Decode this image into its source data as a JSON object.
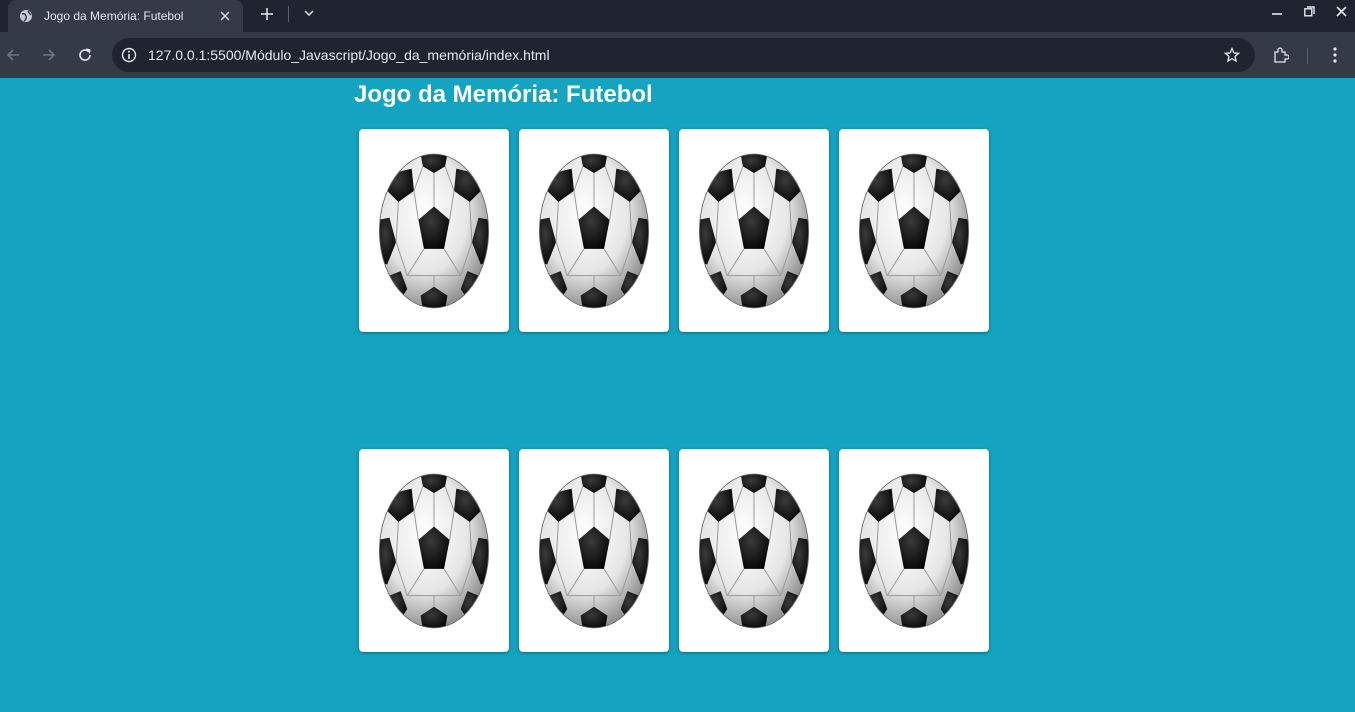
{
  "browser": {
    "tab_title": "Jogo da Memória: Futebol",
    "url": "127.0.0.1:5500/Módulo_Javascript/Jogo_da_memória/index.html",
    "icons": [
      "globe-icon",
      "close-icon",
      "plus-icon",
      "chevron-down-icon",
      "minimize-icon",
      "restore-icon",
      "close-window-icon",
      "back-icon",
      "forward-icon",
      "reload-icon",
      "info-icon",
      "star-icon",
      "extensions-icon",
      "menu-icon"
    ]
  },
  "page": {
    "title": "Jogo da Memória: Futebol",
    "background_color": "#14a3c0",
    "cards": [
      {
        "face": "soccer-ball"
      },
      {
        "face": "soccer-ball"
      },
      {
        "face": "soccer-ball"
      },
      {
        "face": "soccer-ball"
      },
      {
        "face": "soccer-ball"
      },
      {
        "face": "soccer-ball"
      },
      {
        "face": "soccer-ball"
      },
      {
        "face": "soccer-ball"
      }
    ]
  }
}
